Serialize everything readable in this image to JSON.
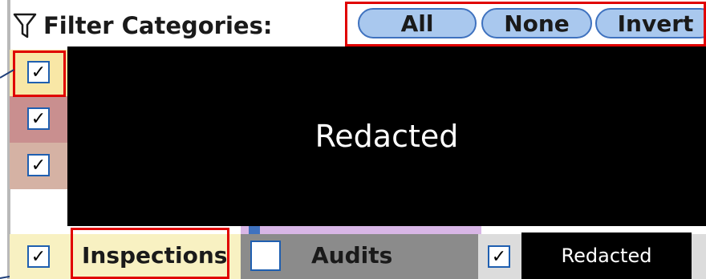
{
  "header": {
    "title": "Filter Categories:",
    "icon": "filter-funnel-icon"
  },
  "buttons": {
    "all": "All",
    "none": "None",
    "invert": "Invert"
  },
  "redactions": {
    "main": "Redacted",
    "bottom": "Redacted"
  },
  "categories": [
    {
      "label": "Inspections",
      "checked": true,
      "color": "#f8f1c2"
    },
    {
      "label": "Audits",
      "checked": false,
      "color": "#8b8b8b"
    }
  ],
  "checkmark": "✓",
  "colors": {
    "pill_fill": "#a9c8ee",
    "pill_border": "#3f72bf",
    "highlight_red": "#e00000",
    "row_yellow": "#f8e7a6",
    "row_red": "#c98f8f",
    "row_tan": "#d5b2a4",
    "audits_purple": "#d8b6e6"
  }
}
